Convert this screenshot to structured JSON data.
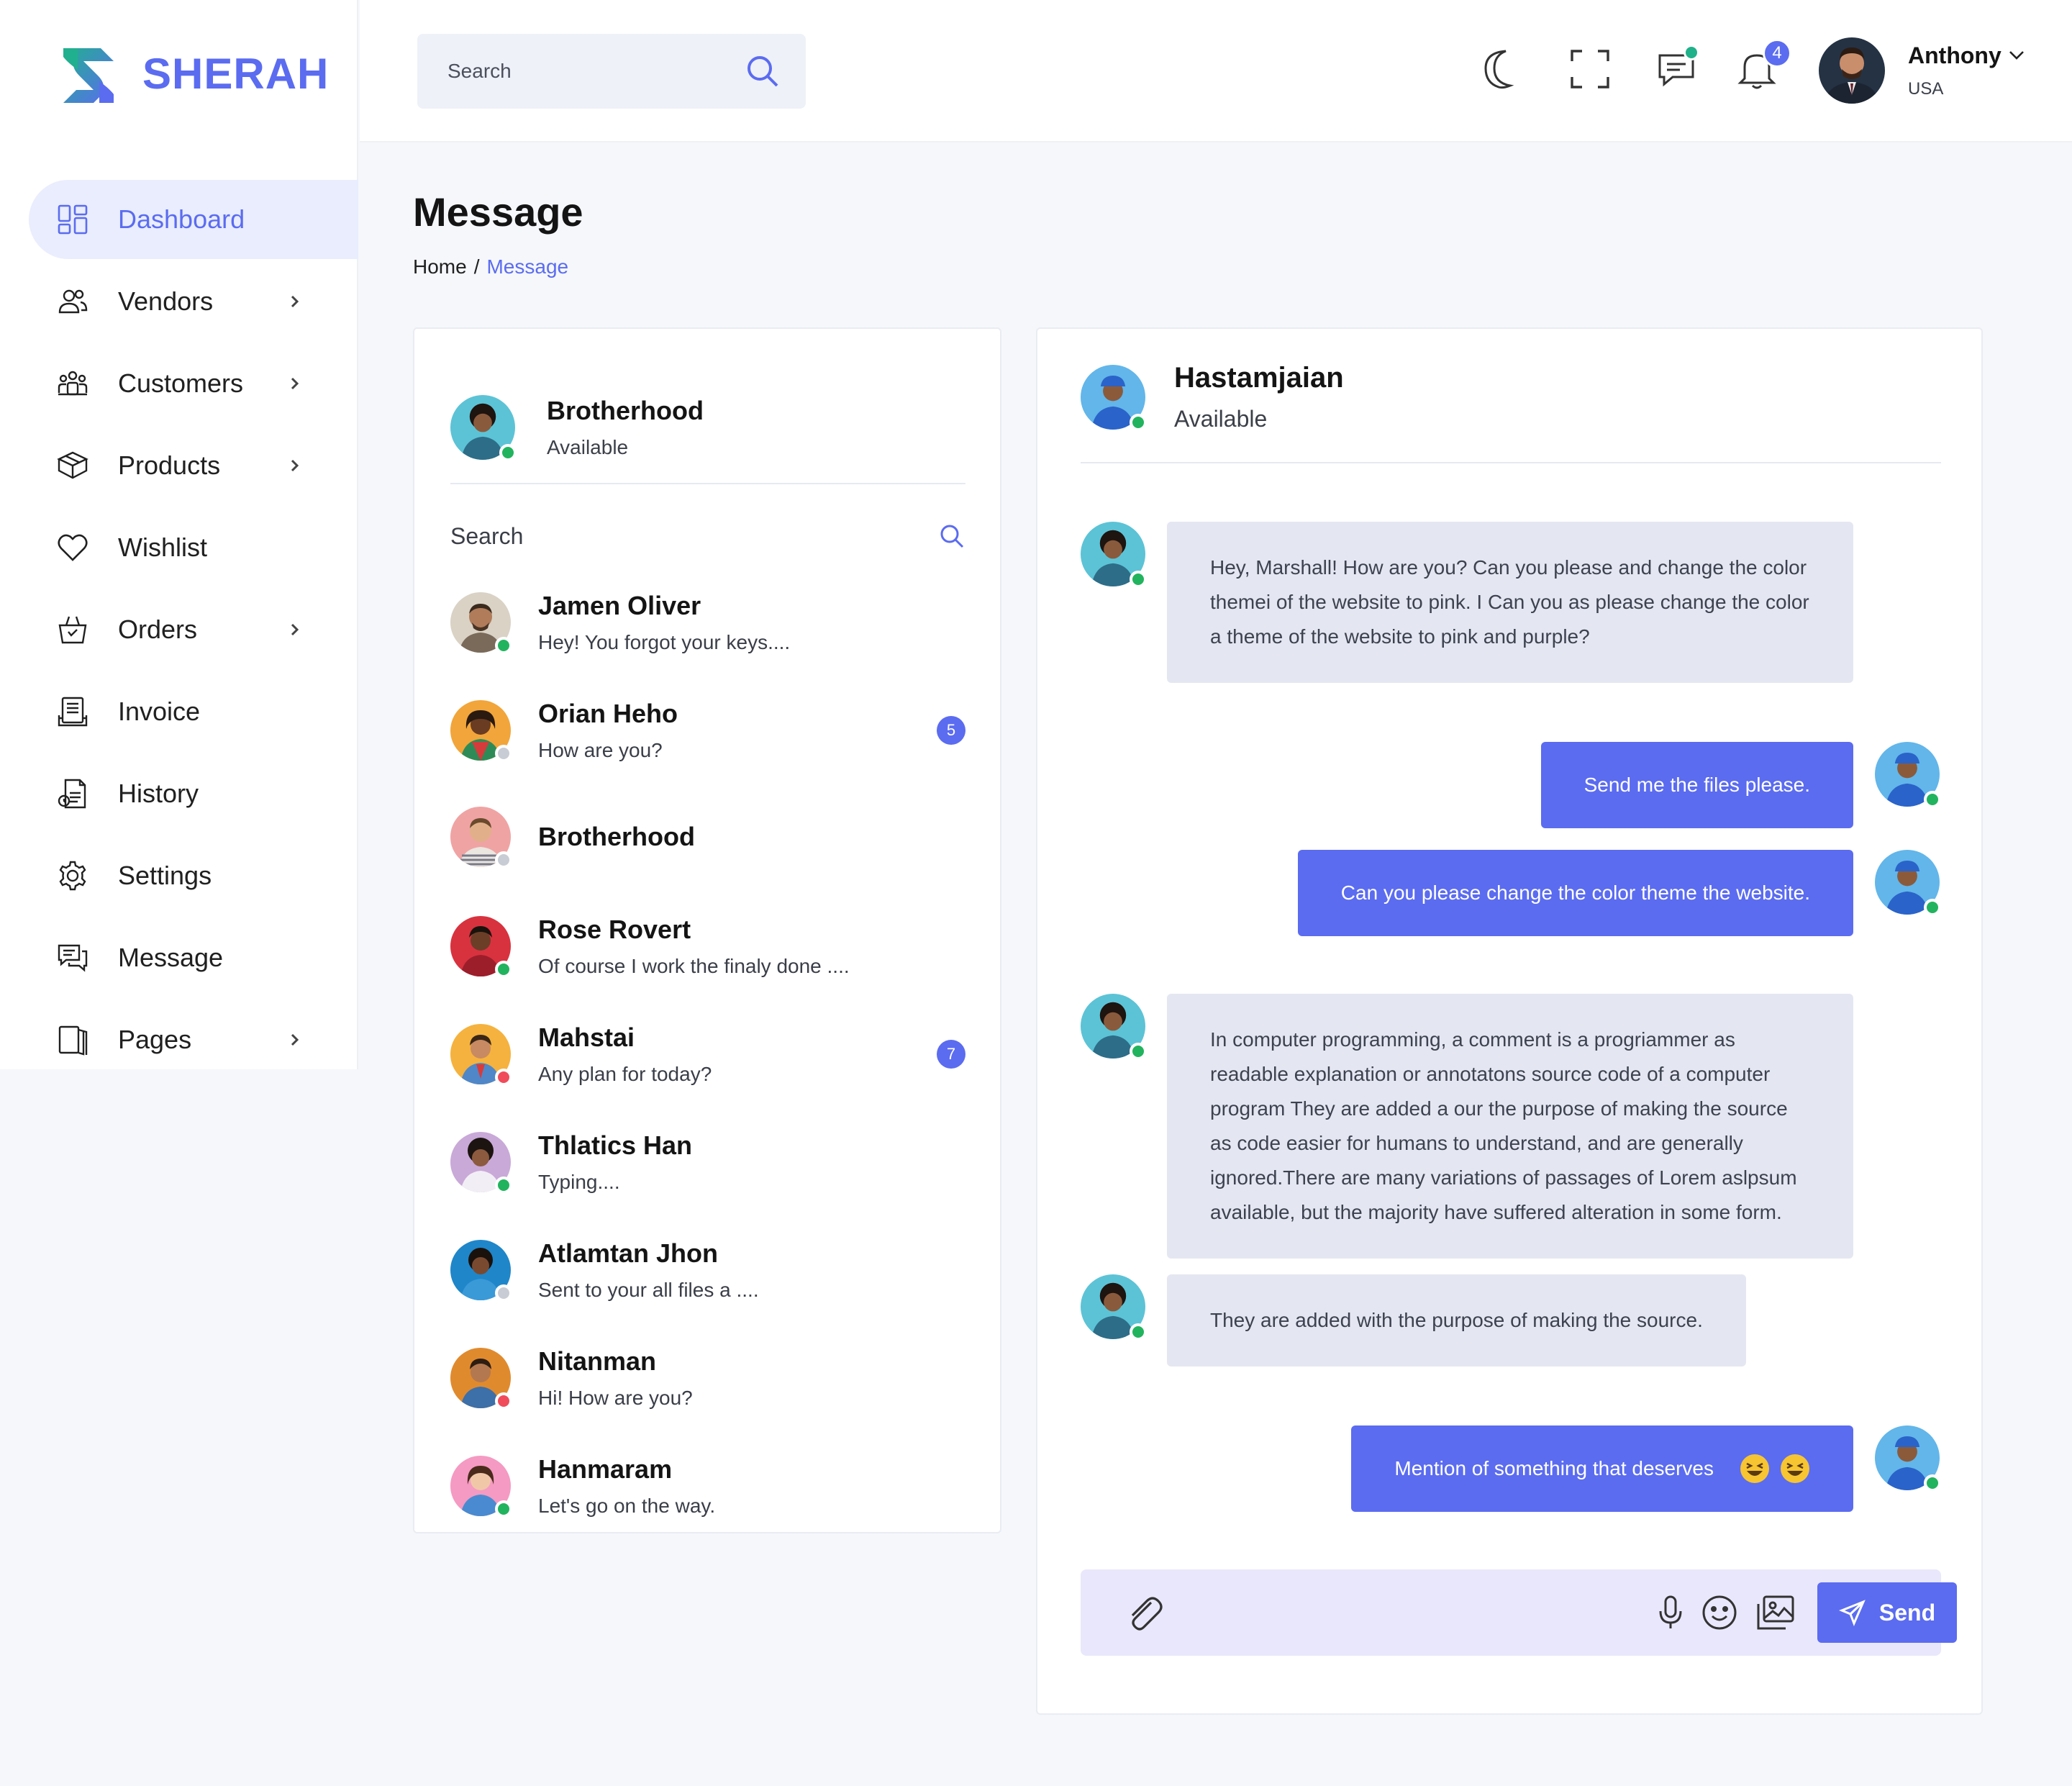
{
  "brand": {
    "name": "SHERAH"
  },
  "sidebar": {
    "items": [
      {
        "label": "Dashboard",
        "icon": "dashboard-icon",
        "active": true,
        "chevron": false
      },
      {
        "label": "Vendors",
        "icon": "vendors-icon",
        "chevron": true
      },
      {
        "label": "Customers",
        "icon": "customers-icon",
        "chevron": true
      },
      {
        "label": "Products",
        "icon": "products-icon",
        "chevron": true
      },
      {
        "label": "Wishlist",
        "icon": "heart-icon",
        "chevron": false
      },
      {
        "label": "Orders",
        "icon": "basket-icon",
        "chevron": true
      },
      {
        "label": "Invoice",
        "icon": "invoice-icon",
        "chevron": false
      },
      {
        "label": "History",
        "icon": "history-icon",
        "chevron": false
      },
      {
        "label": "Settings",
        "icon": "gear-icon",
        "chevron": false
      },
      {
        "label": "Message",
        "icon": "message-icon",
        "chevron": false
      },
      {
        "label": "Pages",
        "icon": "pages-icon",
        "chevron": true
      }
    ]
  },
  "header": {
    "search_placeholder": "Search",
    "notifications_count": "4",
    "profile": {
      "name": "Anthony",
      "country": "USA"
    }
  },
  "page": {
    "title": "Message",
    "breadcrumb": {
      "home": "Home",
      "separator": "/",
      "current": "Message"
    }
  },
  "contacts": {
    "me": {
      "name": "Brotherhood",
      "status": "Available"
    },
    "search_placeholder": "Search",
    "list": [
      {
        "name": "Jamen Oliver",
        "preview": "Hey! You forgot your keys....",
        "status": "online",
        "unread": ""
      },
      {
        "name": "Orian Heho",
        "preview": "How are you?",
        "status": "away",
        "unread": "5"
      },
      {
        "name": "Brotherhood",
        "preview": "",
        "status": "away",
        "unread": ""
      },
      {
        "name": "Rose Rovert",
        "preview": "Of course I work the finaly done ....",
        "status": "online",
        "unread": ""
      },
      {
        "name": "Mahstai",
        "preview": "Any plan for today?",
        "status": "busy",
        "unread": "7"
      },
      {
        "name": "Thlatics Han",
        "preview": "Typing....",
        "status": "online",
        "unread": ""
      },
      {
        "name": "Atlamtan Jhon",
        "preview": "Sent to your all files a ....",
        "status": "away",
        "unread": ""
      },
      {
        "name": "Nitanman",
        "preview": "Hi! How are you?",
        "status": "busy",
        "unread": ""
      },
      {
        "name": "Hanmaram",
        "preview": "Let's go on the way.",
        "status": "online",
        "unread": ""
      }
    ]
  },
  "chat": {
    "partner": {
      "name": "Hastamjaian",
      "status": "Available"
    },
    "messages": [
      {
        "dir": "in",
        "text": "Hey, Marshall! How are you? Can you please and change the color themei of the website to pink. I Can you as please change the color a theme of the website to pink and purple?"
      },
      {
        "dir": "out",
        "text": "Send me the files please."
      },
      {
        "dir": "out",
        "text": "Can you please change the color theme the website."
      },
      {
        "dir": "in",
        "text": "In computer programming, a comment is a progriammer as readable explanation or annotatons source code of a computer program They are added a our the purpose of making the source as code easier for humans to understand, and are generally ignored.There are many variations of passages of Lorem aslpsum available, but the majority have suffered alteration in some form."
      },
      {
        "dir": "in",
        "text": "They are added with the purpose of making the source."
      },
      {
        "dir": "out",
        "text": "Mention of something that deserves"
      }
    ],
    "composer": {
      "send_label": "Send"
    }
  },
  "colors": {
    "accent": "#5b6cf0",
    "online": "#22b35e",
    "away": "#c8ccd4",
    "busy": "#f04b5a",
    "incoming_bubble": "#e4e7f1",
    "composer_bg": "#e9e7fb"
  }
}
